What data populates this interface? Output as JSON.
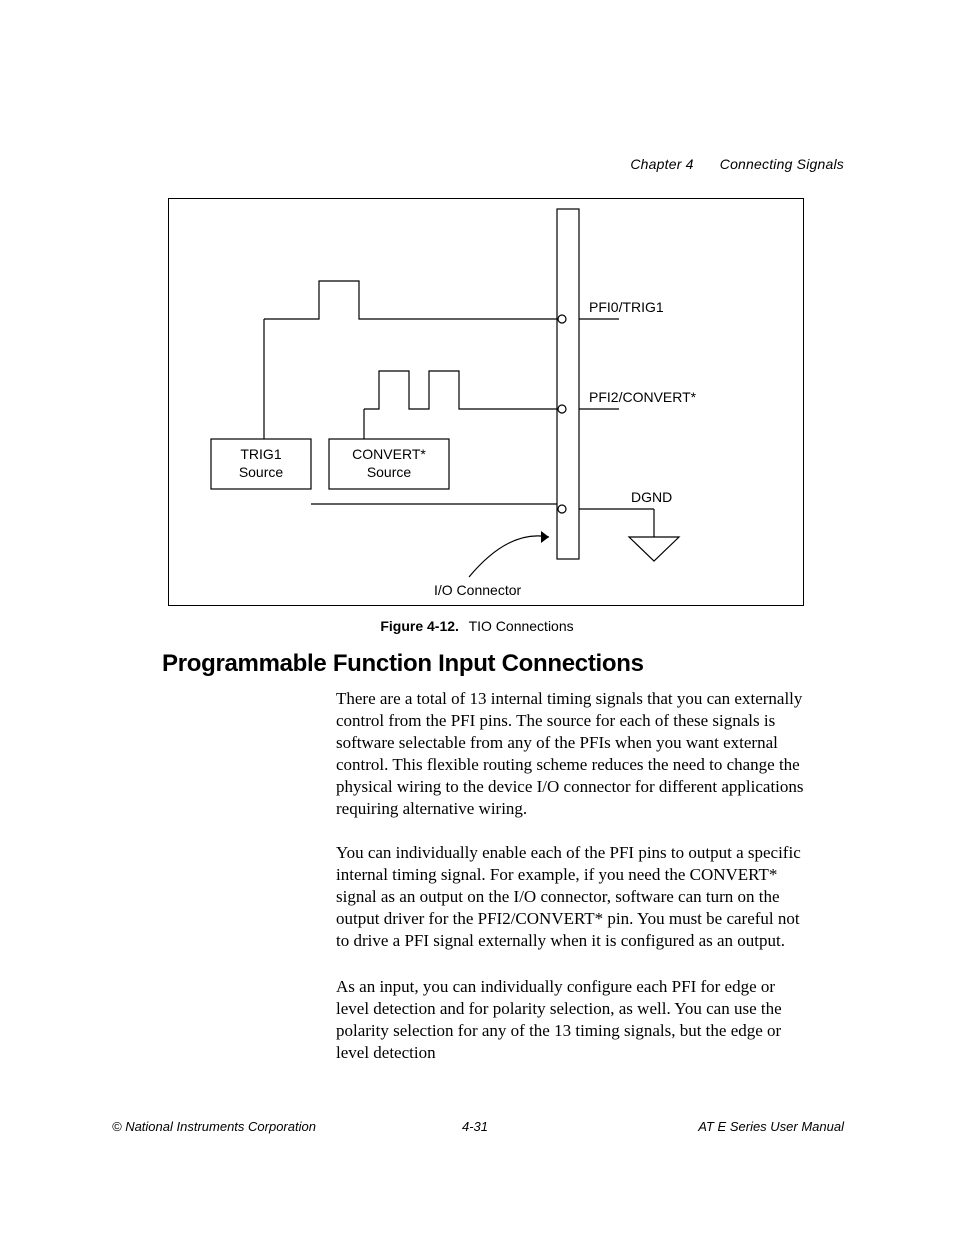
{
  "header": {
    "chapter": "Chapter 4",
    "title": "Connecting Signals"
  },
  "figure": {
    "labels": {
      "pfi0": "PFI0/TRIG1",
      "pfi2": "PFI2/CONVERT*",
      "dgnd": "DGND",
      "trig1_box_l1": "TRIG1",
      "trig1_box_l2": "Source",
      "convert_box_l1": "CONVERT*",
      "convert_box_l2": "Source",
      "ioconn": "I/O Connector"
    },
    "caption_bold": "Figure 4-12.",
    "caption": "TIO Connections"
  },
  "heading": "Programmable Function Input Connections",
  "paragraphs": {
    "p1": "There are a total of 13 internal timing signals that you can externally control from the PFI pins. The source for each of these signals is software selectable from any of the PFIs when you want external control. This flexible routing scheme reduces the need to change the physical wiring to the device I/O connector for different applications requiring alternative wiring.",
    "p2": "You can individually enable each of the PFI pins to output a specific internal timing signal. For example, if you need the CONVERT* signal as an output on the I/O connector, software can turn on the output driver for the PFI2/CONVERT* pin. You must be careful not to drive a PFI signal externally when it is configured as an output.",
    "p3": "As an input, you can individually configure each PFI for edge or level detection and for polarity selection, as well. You can use the polarity selection for any of the 13 timing signals, but the edge or level detection"
  },
  "footer": {
    "left": "© National Instruments Corporation",
    "center": "4-31",
    "right": "AT E Series User Manual"
  }
}
